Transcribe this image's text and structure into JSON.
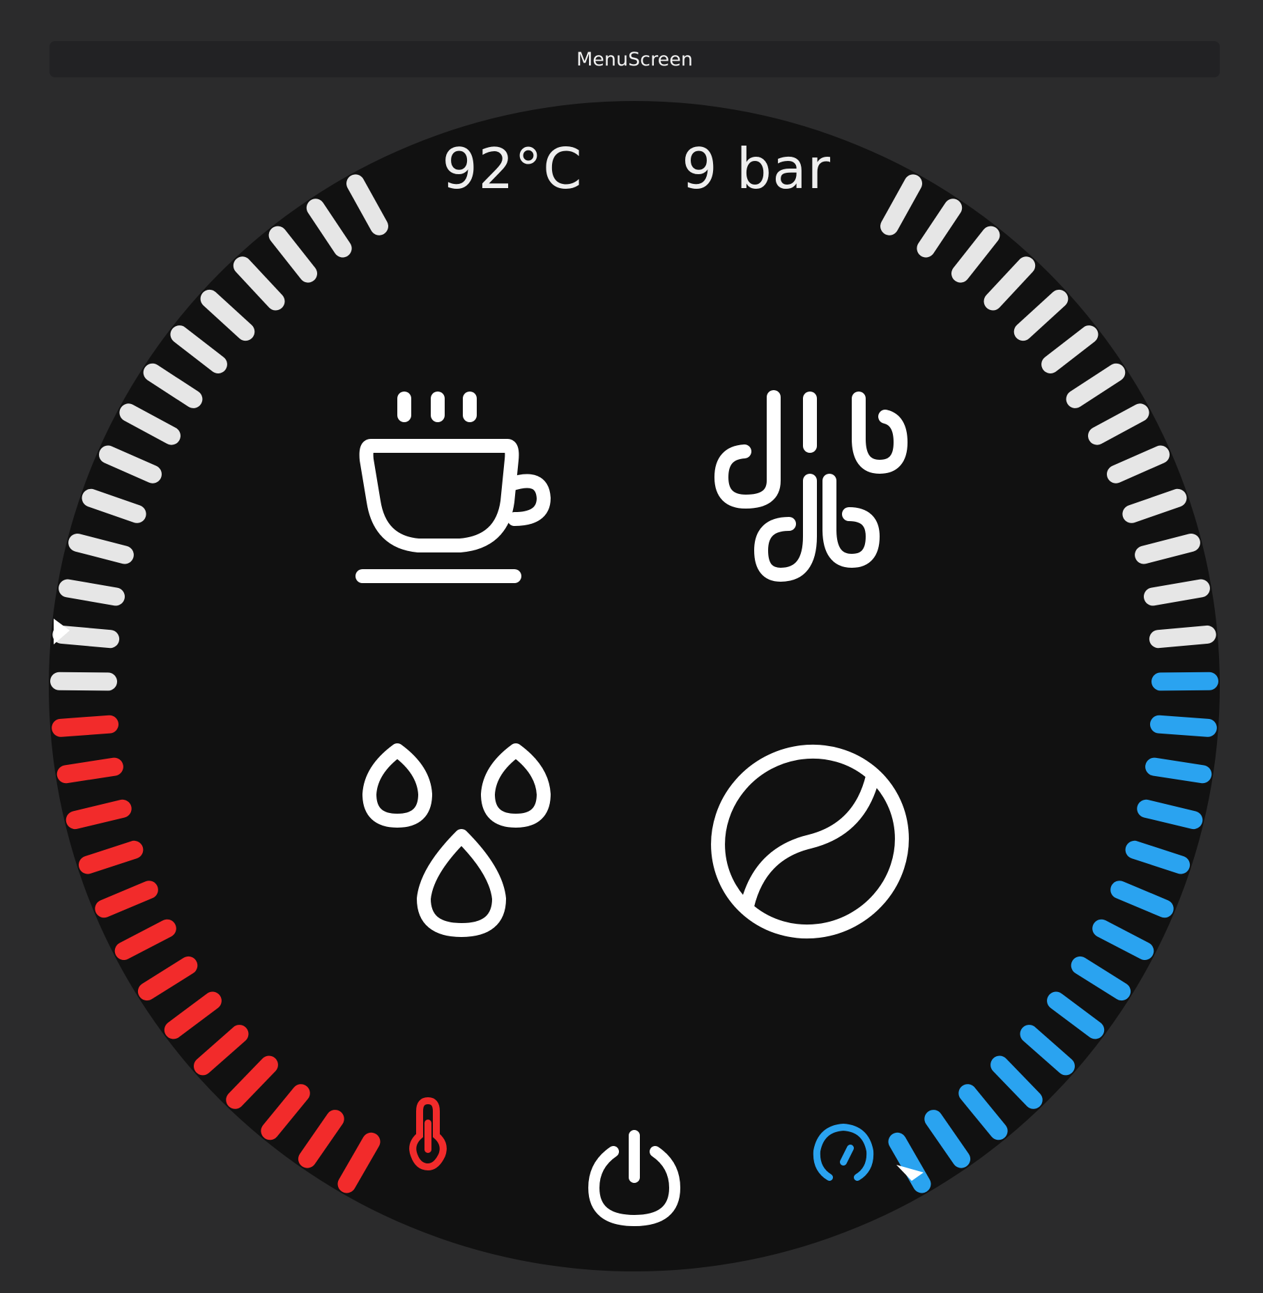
{
  "window": {
    "title": "MenuScreen"
  },
  "readouts": {
    "temperature": "92°C",
    "pressure": "9 bar"
  },
  "gauges": {
    "temperature": {
      "level": 0.47,
      "active_color": "#f22b2b",
      "icon": "thermometer-icon"
    },
    "pressure": {
      "level": 0.5,
      "active_color": "#2aa3f0",
      "icon": "pressure-gauge-icon"
    },
    "inactive_color": "#e6e6e6"
  },
  "menu": {
    "items": [
      {
        "id": "espresso",
        "icon": "coffee-cup-icon"
      },
      {
        "id": "steam",
        "icon": "steam-icon"
      },
      {
        "id": "hot-water",
        "icon": "water-drops-icon"
      },
      {
        "id": "grind",
        "icon": "coffee-bean-icon"
      }
    ],
    "power_icon": "power-icon"
  },
  "colors": {
    "background": "#2b2b2c",
    "dial": "#111111",
    "icons": "#ffffff"
  }
}
